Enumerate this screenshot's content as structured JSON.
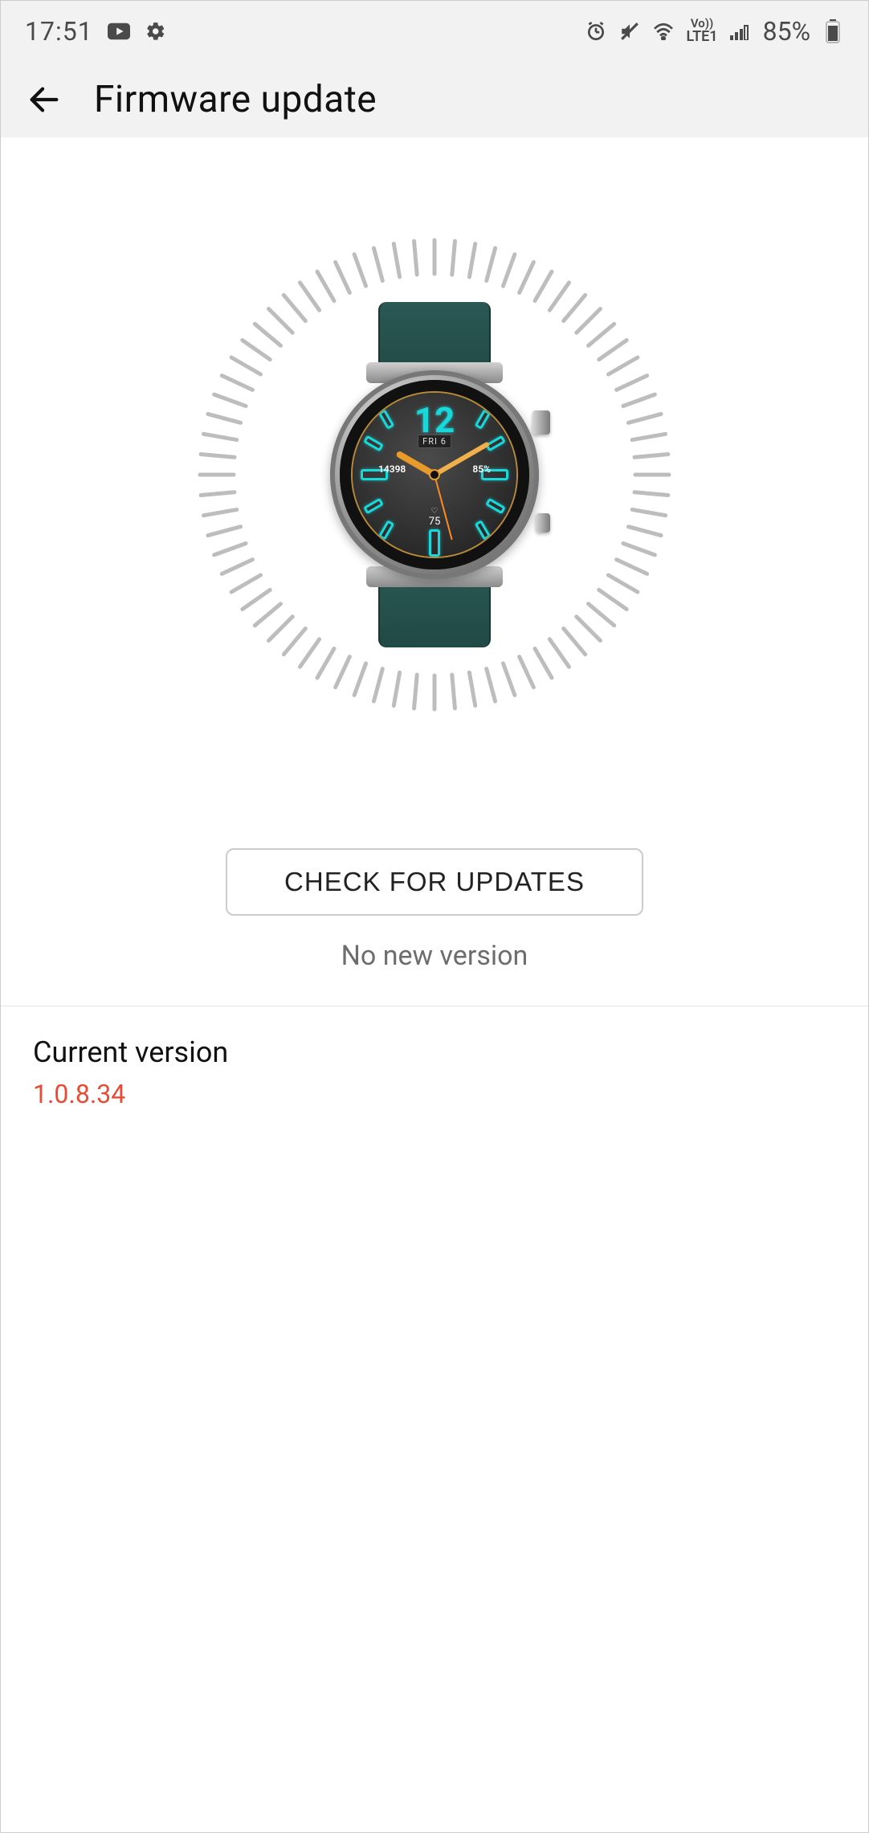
{
  "status_bar": {
    "time": "17:51",
    "battery_text": "85%",
    "lte_label": "LTE1",
    "vo_label": "Vo))"
  },
  "header": {
    "title": "Firmware update"
  },
  "watch_face": {
    "date": "FRI 6",
    "steps": "14398",
    "battery_pct": "85%",
    "heart_rate": "75",
    "big_number": "12"
  },
  "actions": {
    "check_button": "CHECK FOR UPDATES",
    "status_text": "No new version"
  },
  "version": {
    "label": "Current version",
    "value": "1.0.8.34"
  }
}
